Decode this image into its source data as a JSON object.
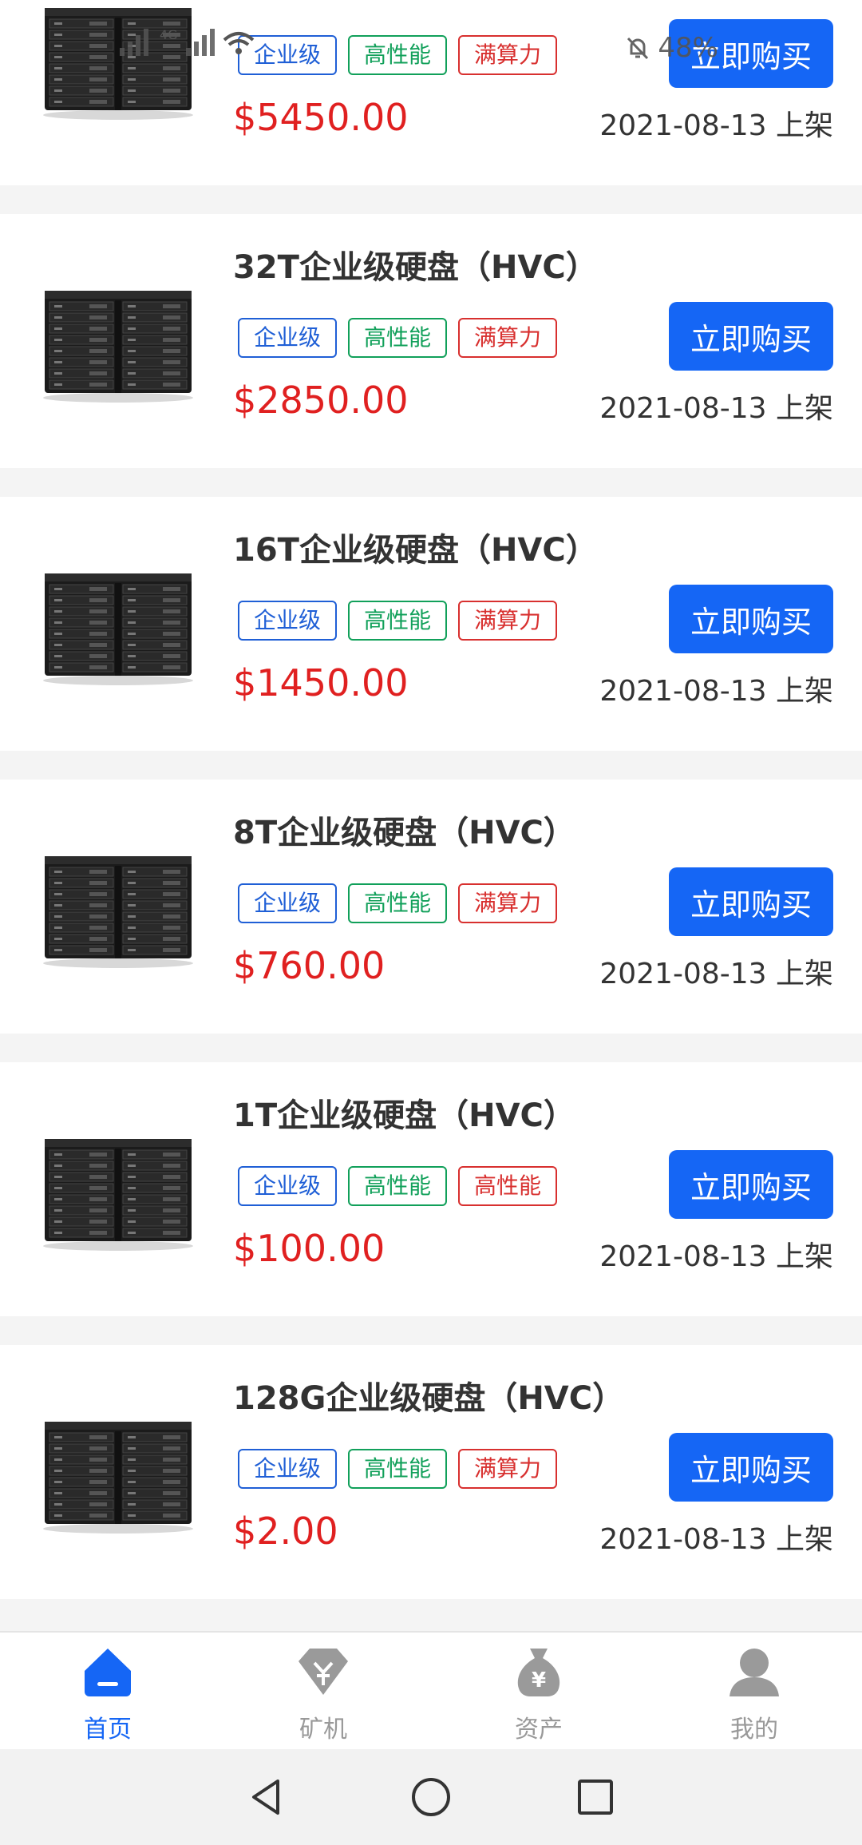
{
  "status_bar": {
    "network": "4G",
    "battery": "48%"
  },
  "products": [
    {
      "name": "",
      "tags": [
        "企业级",
        "高性能",
        "满算力"
      ],
      "price": "$5450.00",
      "date": "2021-08-13 上架",
      "button": "立即购买"
    },
    {
      "name": "32T企业级硬盘（HVC）",
      "tags": [
        "企业级",
        "高性能",
        "满算力"
      ],
      "price": "$2850.00",
      "date": "2021-08-13 上架",
      "button": "立即购买"
    },
    {
      "name": "16T企业级硬盘（HVC）",
      "tags": [
        "企业级",
        "高性能",
        "满算力"
      ],
      "price": "$1450.00",
      "date": "2021-08-13 上架",
      "button": "立即购买"
    },
    {
      "name": "8T企业级硬盘（HVC）",
      "tags": [
        "企业级",
        "高性能",
        "满算力"
      ],
      "price": "$760.00",
      "date": "2021-08-13 上架",
      "button": "立即购买"
    },
    {
      "name": "1T企业级硬盘（HVC）",
      "tags": [
        "企业级",
        "高性能",
        "高性能"
      ],
      "price": "$100.00",
      "date": "2021-08-13 上架",
      "button": "立即购买"
    },
    {
      "name": "128G企业级硬盘（HVC）",
      "tags": [
        "企业级",
        "高性能",
        "满算力"
      ],
      "price": "$2.00",
      "date": "2021-08-13 上架",
      "button": "立即购买"
    }
  ],
  "tag_colors": {
    "blue": "#1f5fd6",
    "green": "#11a05a",
    "red": "#d8302f"
  },
  "accent_color": "#1566f5",
  "price_color": "#e02020",
  "tabbar": [
    {
      "label": "首页",
      "icon": "home-icon",
      "active": true
    },
    {
      "label": "矿机",
      "icon": "diamond-icon",
      "active": false
    },
    {
      "label": "资产",
      "icon": "money-bag-icon",
      "active": false
    },
    {
      "label": "我的",
      "icon": "user-icon",
      "active": false
    }
  ],
  "system_nav": [
    "back-icon",
    "home-circle-icon",
    "recents-icon"
  ]
}
